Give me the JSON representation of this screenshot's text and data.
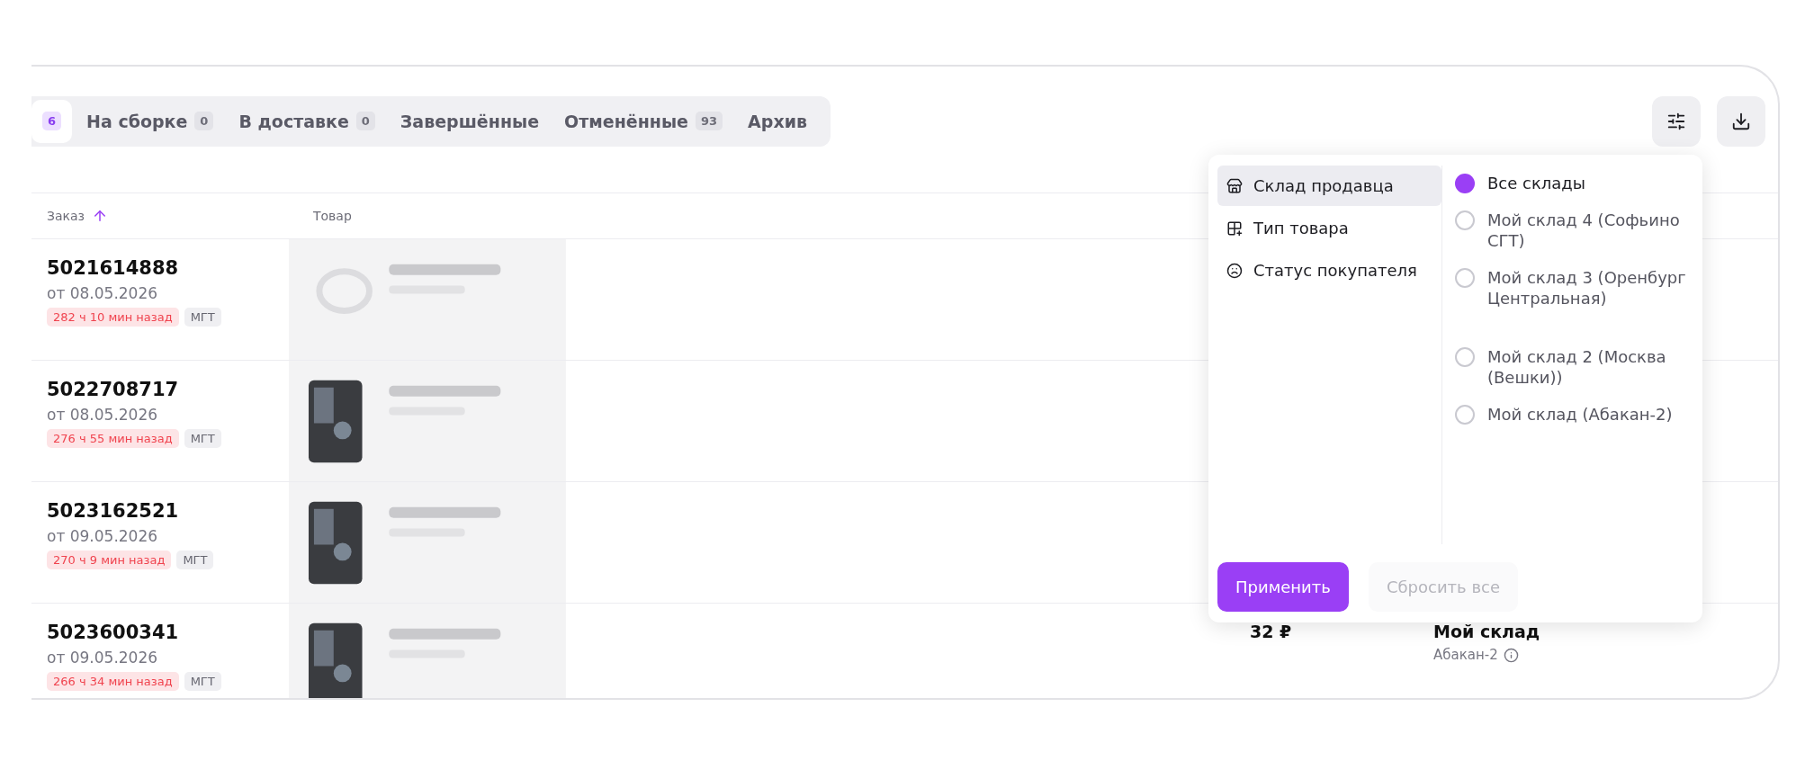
{
  "tabs": [
    {
      "count": "6",
      "selected": true
    },
    {
      "label": "На сборке",
      "count": "0",
      "selected": false
    },
    {
      "label": "В доставке",
      "count": "0",
      "selected": false
    },
    {
      "label": "Завершённые",
      "selected": false
    },
    {
      "label": "Отменённые",
      "count": "93",
      "selected": false
    },
    {
      "label": "Архив",
      "selected": false
    }
  ],
  "table": {
    "columns": [
      {
        "label": "Заказ",
        "sorted": true
      },
      {
        "label": "Товар"
      }
    ],
    "rows": [
      {
        "order": "5021614888",
        "date": "от 08.05.2026",
        "overdue": "282 ч 10 мин назад",
        "tag": "МГТ"
      },
      {
        "order": "5022708717",
        "date": "от 08.05.2026",
        "overdue": "276 ч 55 мин назад",
        "tag": "МГТ"
      },
      {
        "order": "5023162521",
        "date": "от 09.05.2026",
        "overdue": "270 ч 9 мин назад",
        "tag": "МГТ"
      },
      {
        "order": "5023600341",
        "date": "от 09.05.2026",
        "overdue": "266 ч 34 мин назад",
        "tag": "МГТ",
        "price": "32 ₽",
        "warehouse": "Мой склад",
        "warehouse_city": "Абакан-2"
      }
    ]
  },
  "filter_panel": {
    "categories": [
      {
        "label": "Склад продавца",
        "selected": true
      },
      {
        "label": "Тип товара",
        "selected": false
      },
      {
        "label": "Статус покупателя",
        "selected": false
      }
    ],
    "options": [
      {
        "label": "Все склады",
        "selected": true
      },
      {
        "label": "Мой склад 4 (Софьино СГТ)",
        "selected": false
      },
      {
        "label": "Мой склад 3 (Оренбург Центральная)",
        "selected": false
      },
      {
        "label": "Мой склад 2 (Москва (Вешки))",
        "selected": false
      },
      {
        "label": "Мой склад (Абакан-2)",
        "selected": false
      }
    ],
    "apply": "Применить",
    "reset": {
      "label": "Сбросить все",
      "disabled": true
    }
  }
}
